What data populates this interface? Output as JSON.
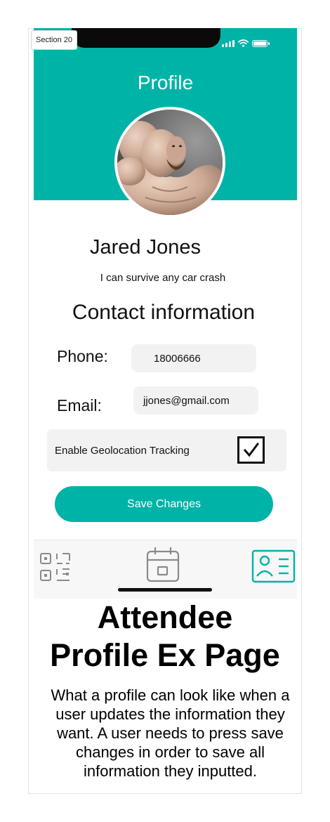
{
  "section_tag": "Section 20",
  "header": {
    "title": "Profile"
  },
  "profile": {
    "name": "Jared Jones",
    "bio": "I can survive any car crash"
  },
  "contact": {
    "heading": "Contact information",
    "phone_label": "Phone:",
    "phone_value": "18006666",
    "email_label": "Email:",
    "email_value": "jjones@gmail.com"
  },
  "geolocation": {
    "label": "Enable Geolocation Tracking",
    "checked": true
  },
  "save_button": "Save Changes",
  "tabbar": {
    "items": [
      {
        "icon": "qr-code-icon"
      },
      {
        "icon": "calendar-icon"
      },
      {
        "icon": "profile-card-icon",
        "active": true
      }
    ]
  },
  "annotation": {
    "title_line1": "Attendee",
    "title_line2": "Profile Ex Page",
    "description": "What a profile can look like when a user updates the information they want. A user needs to press save changes in order to save all information they inputted."
  },
  "colors": {
    "accent": "#00b3a7",
    "field_bg": "#f2f2f2",
    "tab_inactive": "#8a8a8a"
  }
}
